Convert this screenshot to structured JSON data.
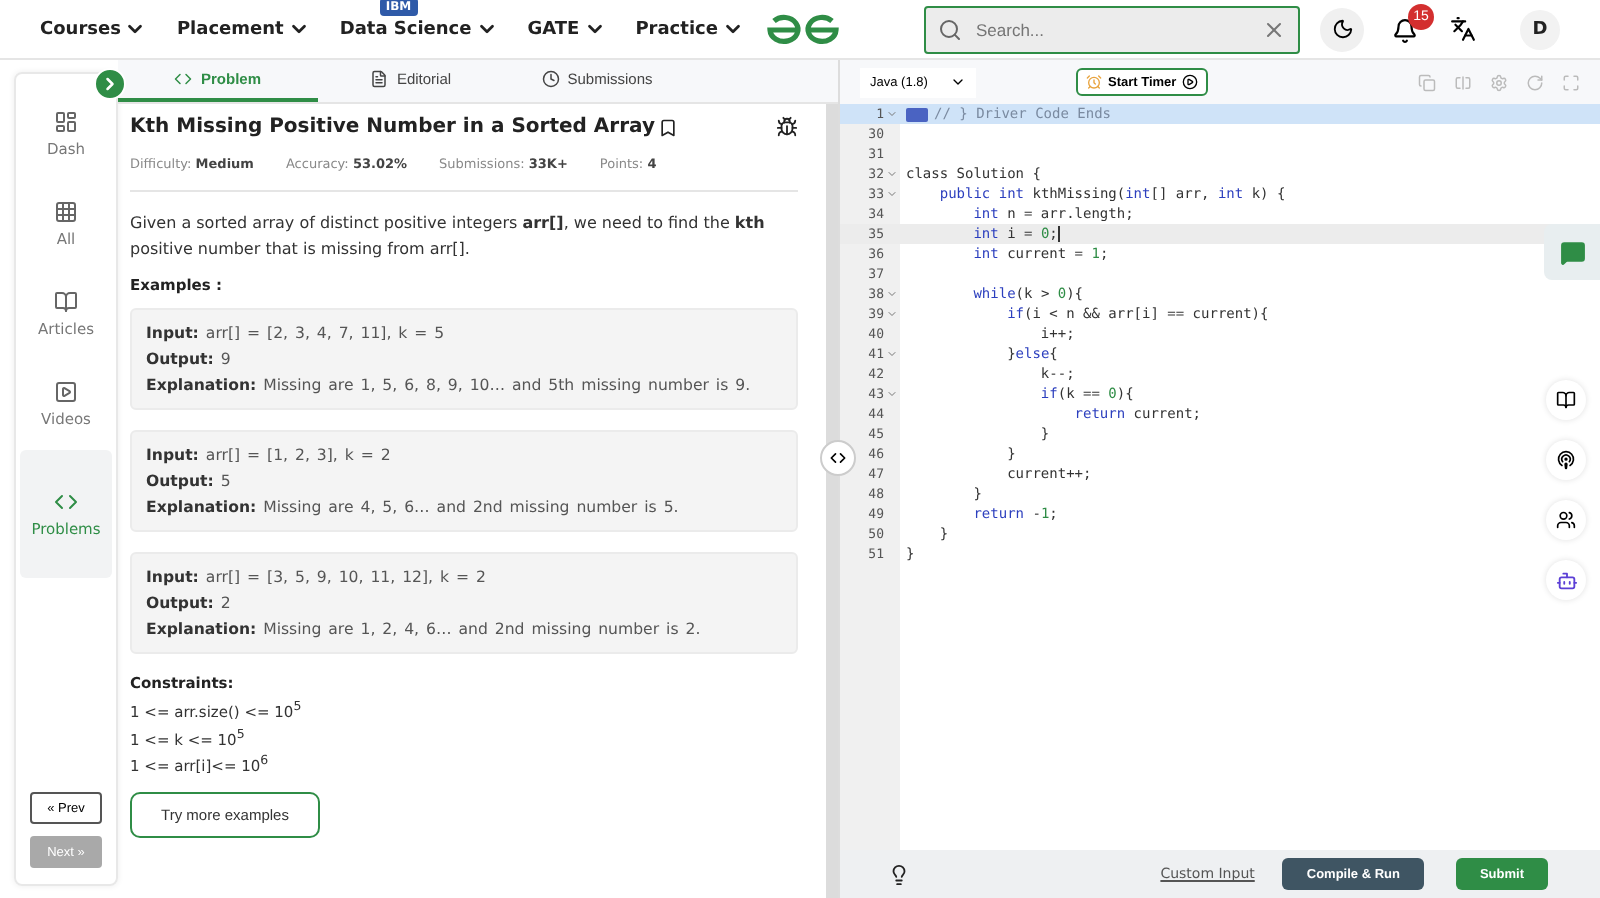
{
  "nav": {
    "items": [
      {
        "label": "Courses"
      },
      {
        "label": "Placement"
      },
      {
        "label": "Data Science",
        "badge": "IBM"
      },
      {
        "label": "GATE"
      },
      {
        "label": "Practice"
      }
    ],
    "search": {
      "placeholder": "Search..."
    },
    "notifications": "15",
    "avatar": "D"
  },
  "sidebar": {
    "items": [
      {
        "label": "Dash",
        "selected": false
      },
      {
        "label": "All",
        "selected": false
      },
      {
        "label": "Articles",
        "selected": false
      },
      {
        "label": "Videos",
        "selected": false
      },
      {
        "label": "Problems",
        "selected": true
      }
    ],
    "prev": {
      "label": "« Prev",
      "disabled": false
    },
    "next": {
      "label": "Next »",
      "disabled": true
    }
  },
  "tabs": [
    {
      "label": "Problem",
      "selected": true
    },
    {
      "label": "Editorial",
      "selected": false
    },
    {
      "label": "Submissions",
      "selected": false
    }
  ],
  "problem": {
    "title": "Kth Missing Positive Number in a Sorted Array",
    "meta": [
      {
        "label": "Difficulty:",
        "value": "Medium"
      },
      {
        "label": "Accuracy:",
        "value": "53.02%"
      },
      {
        "label": "Submissions:",
        "value": "33K+"
      },
      {
        "label": "Points:",
        "value": "4"
      }
    ],
    "description": "Given a sorted array of distinct positive integers **arr[]**, we need to find the **kth** positive number that is missing from arr[].",
    "examples_heading": "Examples :",
    "examples": [
      {
        "lines": [
          {
            "label": "Input:",
            "text": "arr[] = [2, 3, 4, 7, 11], k = 5"
          },
          {
            "label": "Output:",
            "text": "9"
          },
          {
            "label": "Explanation:",
            "text": "Missing are 1, 5, 6, 8, 9, 10… and 5th missing number is 9."
          }
        ]
      },
      {
        "lines": [
          {
            "label": "Input:",
            "text": "arr[] = [1, 2, 3], k = 2"
          },
          {
            "label": "Output:",
            "text": "5"
          },
          {
            "label": "Explanation:",
            "text": "Missing are 4, 5, 6… and 2nd missing number is 5."
          }
        ]
      },
      {
        "lines": [
          {
            "label": "Input:",
            "text": "arr[] = [3, 5, 9, 10, 11, 12], k = 2"
          },
          {
            "label": "Output:",
            "text": "2"
          },
          {
            "label": "Explanation:",
            "text": "Missing are 1, 2, 4, 6… and 2nd missing number is 2."
          }
        ]
      }
    ],
    "constraints_heading": "Constraints:",
    "constraints": [
      "1 <= arr.size() <= 10$^{5}$",
      "1 <= k <= 10$^{5}$",
      "1 <= arr[i]<= 10$^{6}$"
    ],
    "more_button": "Try more examples"
  },
  "editor": {
    "language": "Java (1.8)",
    "timer": "Start Timer",
    "lines": [
      {
        "num": "1",
        "fold": true,
        "collapsed": true,
        "current": false,
        "parts": [
          {
            "kind": "comment",
            "text": "// } Driver Code Ends"
          }
        ]
      },
      {
        "num": "30",
        "fold": false,
        "collapsed": false,
        "current": false
      },
      {
        "num": "31",
        "fold": false,
        "collapsed": false,
        "current": false
      },
      {
        "num": "32",
        "fold": true,
        "collapsed": false,
        "current": false,
        "parts": [
          {
            "kind": "plain",
            "text": "class Solution {"
          }
        ]
      },
      {
        "num": "33",
        "fold": true,
        "collapsed": false,
        "current": false,
        "parts": [
          {
            "kind": "kw",
            "text": "    public int"
          },
          {
            "kind": "plain",
            "text": " kthMissing("
          },
          {
            "kind": "kw",
            "text": "int"
          },
          {
            "kind": "plain",
            "text": "[] arr, "
          },
          {
            "kind": "kw",
            "text": "int"
          },
          {
            "kind": "plain",
            "text": " k) {"
          }
        ]
      },
      {
        "num": "34",
        "fold": false,
        "collapsed": false,
        "current": false,
        "parts": [
          {
            "kind": "kw",
            "text": "        int"
          },
          {
            "kind": "plain",
            "text": " n = arr.length;"
          }
        ]
      },
      {
        "num": "35",
        "fold": false,
        "collapsed": false,
        "current": true,
        "parts": [
          {
            "kind": "kw",
            "text": "        int"
          },
          {
            "kind": "plain",
            "text": " i = "
          },
          {
            "kind": "num",
            "text": "0"
          },
          {
            "kind": "plain",
            "text": ";"
          }
        ]
      },
      {
        "num": "36",
        "fold": false,
        "collapsed": false,
        "current": false,
        "parts": [
          {
            "kind": "kw",
            "text": "        int"
          },
          {
            "kind": "plain",
            "text": " current = "
          },
          {
            "kind": "num",
            "text": "1"
          },
          {
            "kind": "plain",
            "text": ";"
          }
        ]
      },
      {
        "num": "37",
        "fold": false,
        "collapsed": false,
        "current": false
      },
      {
        "num": "38",
        "fold": true,
        "collapsed": false,
        "current": false,
        "parts": [
          {
            "kind": "kw",
            "text": "        while"
          },
          {
            "kind": "plain",
            "text": "(k > "
          },
          {
            "kind": "num",
            "text": "0"
          },
          {
            "kind": "plain",
            "text": "){"
          }
        ]
      },
      {
        "num": "39",
        "fold": true,
        "collapsed": false,
        "current": false,
        "parts": [
          {
            "kind": "kw",
            "text": "            if"
          },
          {
            "kind": "plain",
            "text": "(i < n && arr[i] == current){"
          }
        ]
      },
      {
        "num": "40",
        "fold": false,
        "collapsed": false,
        "current": false,
        "parts": [
          {
            "kind": "plain",
            "text": "                i++;"
          }
        ]
      },
      {
        "num": "41",
        "fold": true,
        "collapsed": false,
        "current": false,
        "parts": [
          {
            "kind": "plain",
            "text": "            }"
          },
          {
            "kind": "kw",
            "text": "else"
          },
          {
            "kind": "plain",
            "text": "{"
          }
        ]
      },
      {
        "num": "42",
        "fold": false,
        "collapsed": false,
        "current": false,
        "parts": [
          {
            "kind": "plain",
            "text": "                k--;"
          }
        ]
      },
      {
        "num": "43",
        "fold": true,
        "collapsed": false,
        "current": false,
        "parts": [
          {
            "kind": "kw",
            "text": "                if"
          },
          {
            "kind": "plain",
            "text": "(k == "
          },
          {
            "kind": "num",
            "text": "0"
          },
          {
            "kind": "plain",
            "text": "){"
          }
        ]
      },
      {
        "num": "44",
        "fold": false,
        "collapsed": false,
        "current": false,
        "parts": [
          {
            "kind": "kw",
            "text": "                    return"
          },
          {
            "kind": "plain",
            "text": " current;"
          }
        ]
      },
      {
        "num": "45",
        "fold": false,
        "collapsed": false,
        "current": false,
        "parts": [
          {
            "kind": "plain",
            "text": "                }"
          }
        ]
      },
      {
        "num": "46",
        "fold": false,
        "collapsed": false,
        "current": false,
        "parts": [
          {
            "kind": "plain",
            "text": "            }"
          }
        ]
      },
      {
        "num": "47",
        "fold": false,
        "collapsed": false,
        "current": false,
        "parts": [
          {
            "kind": "plain",
            "text": "            current++;"
          }
        ]
      },
      {
        "num": "48",
        "fold": false,
        "collapsed": false,
        "current": false,
        "parts": [
          {
            "kind": "plain",
            "text": "        }"
          }
        ]
      },
      {
        "num": "49",
        "fold": false,
        "collapsed": false,
        "current": false,
        "parts": [
          {
            "kind": "kw",
            "text": "        return"
          },
          {
            "kind": "plain",
            "text": " -"
          },
          {
            "kind": "num",
            "text": "1"
          },
          {
            "kind": "plain",
            "text": ";"
          }
        ]
      },
      {
        "num": "50",
        "fold": false,
        "collapsed": false,
        "current": false,
        "parts": [
          {
            "kind": "plain",
            "text": "    }"
          }
        ]
      },
      {
        "num": "51",
        "fold": false,
        "collapsed": false,
        "current": false,
        "parts": [
          {
            "kind": "plain",
            "text": "}"
          }
        ]
      }
    ],
    "custom_input": "Custom Input",
    "run": "Compile & Run",
    "submit": "Submit"
  }
}
